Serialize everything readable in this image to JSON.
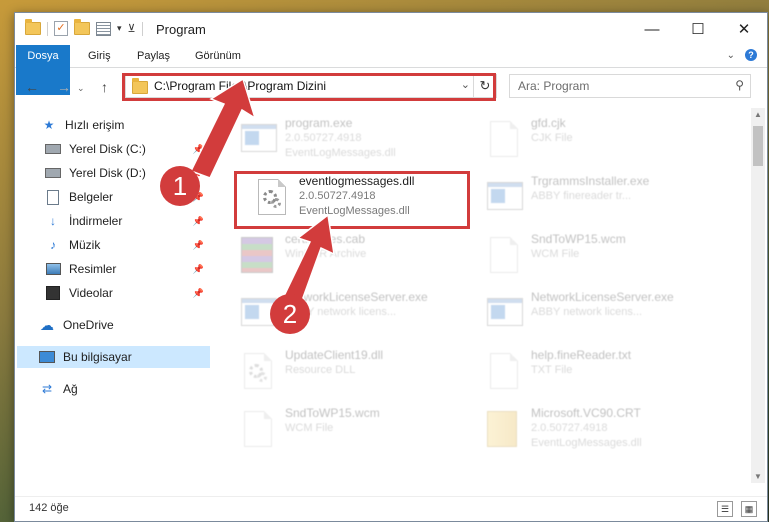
{
  "window": {
    "title": "Program",
    "controls": {
      "minimize": "—",
      "maximize": "☐",
      "close": "✕"
    }
  },
  "ribbon": {
    "tabs": [
      "Dosya",
      "Giriş",
      "Paylaş",
      "Görünüm"
    ],
    "expand_icon": "chevron-down-icon",
    "help_icon": "help-icon"
  },
  "navigation": {
    "address": "C:\\Program Files\\Program Dizini",
    "search_placeholder": "Ara: Program"
  },
  "sidebar": {
    "items": [
      {
        "label": "Hızlı erişim",
        "icon": "star-icon",
        "pinned": false
      },
      {
        "label": "Yerel Disk (C:)",
        "icon": "drive-icon",
        "pinned": true
      },
      {
        "label": "Yerel Disk (D:)",
        "icon": "drive-icon",
        "pinned": true
      },
      {
        "label": "Belgeler",
        "icon": "documents-icon",
        "pinned": true
      },
      {
        "label": "İndirmeler",
        "icon": "download-icon",
        "pinned": true
      },
      {
        "label": "Müzik",
        "icon": "music-icon",
        "pinned": true
      },
      {
        "label": "Resimler",
        "icon": "pictures-icon",
        "pinned": true
      },
      {
        "label": "Videolar",
        "icon": "video-icon",
        "pinned": true
      },
      {
        "label": "OneDrive",
        "icon": "cloud-icon",
        "pinned": false
      },
      {
        "label": "Bu bilgisayar",
        "icon": "computer-icon",
        "pinned": false,
        "selected": true
      },
      {
        "label": "Ağ",
        "icon": "network-icon",
        "pinned": false
      }
    ]
  },
  "files": [
    {
      "name": "program.exe",
      "line1": "2.0.50727.4918",
      "line2": "EventLogMessages.dll",
      "icon": "exe-icon",
      "faded": true
    },
    {
      "name": "gfd.cjk",
      "line1": "CJK File",
      "line2": "",
      "icon": "file-icon",
      "faded": true
    },
    {
      "name": "eventlogmessages.dll",
      "line1": "2.0.50727.4918",
      "line2": "EventLogMessages.dll",
      "icon": "dll-gear-icon",
      "faded": false
    },
    {
      "name": "TrgrammsInstaller.exe",
      "line1": "ABBY finereader tr...",
      "line2": "",
      "icon": "exe-icon",
      "faded": true
    },
    {
      "name": "certificates.cab",
      "line1": "WinRAR Archive",
      "line2": "",
      "icon": "winrar-icon",
      "faded": true
    },
    {
      "name": "SndToWP15.wcm",
      "line1": "WCM File",
      "line2": "",
      "icon": "file-icon",
      "faded": true
    },
    {
      "name": "NetworkLicenseServer.exe",
      "line1": "ABBY network licens...",
      "line2": "",
      "icon": "exe-icon",
      "faded": true
    },
    {
      "name": "NetworkLicenseServer.exe",
      "line1": "ABBY network licens...",
      "line2": "",
      "icon": "exe-icon",
      "faded": true
    },
    {
      "name": "UpdateClient19.dll",
      "line1": "Resource DLL",
      "line2": "",
      "icon": "dll-gear-icon",
      "faded": true
    },
    {
      "name": "help.fineReader.txt",
      "line1": "TXT File",
      "line2": "",
      "icon": "file-icon",
      "faded": true
    },
    {
      "name": "SndToWP15.wcm",
      "line1": "WCM File",
      "line2": "",
      "icon": "file-icon",
      "faded": true
    },
    {
      "name": "Microsoft.VC90.CRT",
      "line1": "2.0.50727.4918",
      "line2": "EventLogMessages.dll",
      "icon": "package-icon",
      "faded": true
    }
  ],
  "status": {
    "count": "142 öğe"
  },
  "annotations": {
    "step1": "1",
    "step2": "2",
    "color": "#d23c3c"
  }
}
